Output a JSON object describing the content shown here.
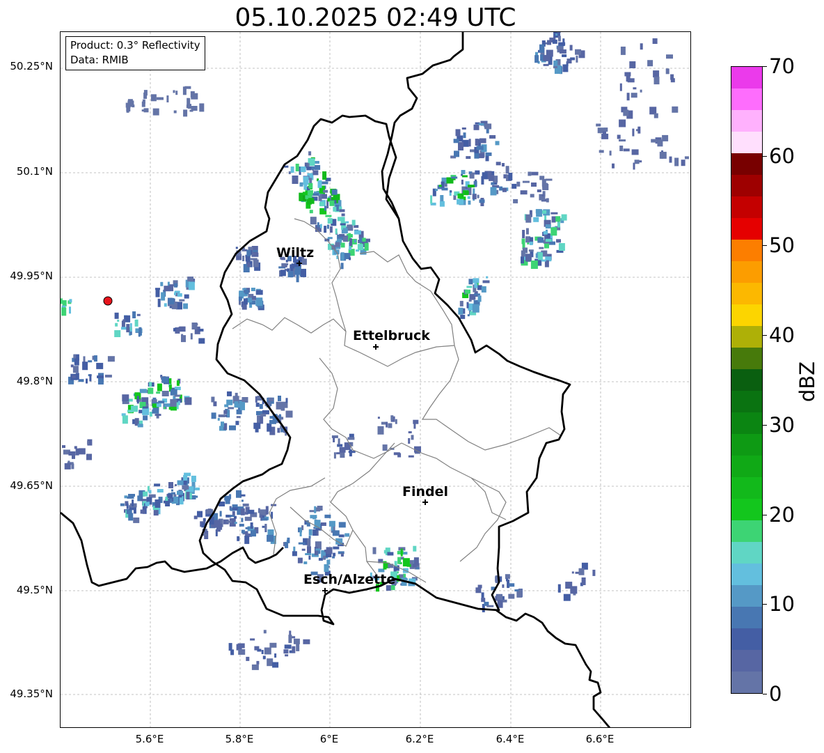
{
  "title": "05.10.2025 02:49 UTC",
  "info": {
    "product": "Product: 0.3° Reflectivity",
    "data": "Data: RMIB"
  },
  "lat_labels": [
    "50.25°N",
    "50.1°N",
    "49.95°N",
    "49.8°N",
    "49.65°N",
    "49.5°N",
    "49.35°N"
  ],
  "lon_labels": [
    "5.6°E",
    "5.8°E",
    "6°E",
    "6.2°E",
    "6.4°E",
    "6.6°E"
  ],
  "cities": [
    {
      "name": "Wiltz"
    },
    {
      "name": "Ettelbruck"
    },
    {
      "name": "Findel"
    },
    {
      "name": "Esch/Alzette"
    }
  ],
  "radar_site": {
    "icon": "radar-site-marker",
    "color": "#e8141c"
  },
  "colorbar": {
    "label": "dBZ",
    "ticks": [
      "0",
      "10",
      "20",
      "30",
      "40",
      "50",
      "60",
      "70"
    ],
    "colors": [
      "#6474a7",
      "#5766a3",
      "#445ea4",
      "#4877b2",
      "#5599c6",
      "#63bfde",
      "#60d6c4",
      "#3dd474",
      "#13c61d",
      "#12b91b",
      "#10a916",
      "#0e9a14",
      "#0b8512",
      "#0a7311",
      "#0a5f10",
      "#477a0b",
      "#aeb007",
      "#fcd500",
      "#fcb800",
      "#fc9d00",
      "#fc7e00",
      "#e50000",
      "#c40000",
      "#9e0000",
      "#780000",
      "#ffdffd",
      "#ffb1fd",
      "#fe6dfd",
      "#eb3aeb"
    ]
  },
  "colors": {
    "border_national": "#000000",
    "border_canton": "#808080",
    "grid": "#b0b0b0"
  }
}
